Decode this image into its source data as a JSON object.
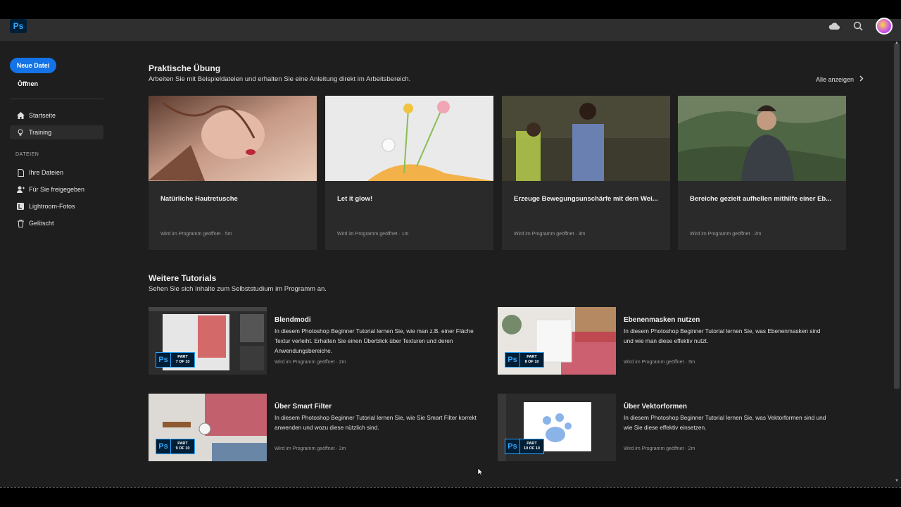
{
  "appbar": {
    "logo": "Ps",
    "cloud_icon": "cloud-icon",
    "search_icon": "search-icon"
  },
  "sidebar": {
    "new_file": "Neue Datei",
    "open": "Öffnen",
    "nav": [
      {
        "label": "Startseite",
        "icon": "home-icon"
      },
      {
        "label": "Training",
        "icon": "lightbulb-icon"
      }
    ],
    "files_heading": "DATEIEN",
    "files": [
      {
        "label": "Ihre Dateien",
        "icon": "file-icon"
      },
      {
        "label": "Für Sie freigegeben",
        "icon": "shared-user-icon"
      },
      {
        "label": "Lightroom-Fotos",
        "icon": "lightroom-icon"
      },
      {
        "label": "Gelöscht",
        "icon": "trash-icon"
      }
    ]
  },
  "practice": {
    "title": "Praktische Übung",
    "subtitle": "Arbeiten Sie mit Beispieldateien und erhalten Sie eine Anleitung direkt im Arbeitsbereich.",
    "see_all": "Alle anzeigen",
    "cards": [
      {
        "title": "Natürliche Hautretusche",
        "meta": "Wird im Programm geöffnet  ·  5m"
      },
      {
        "title": "Let it glow!",
        "meta": "Wird im Programm geöffnet  ·  1m"
      },
      {
        "title": "Erzeuge Bewegungsunschärfe mit dem Wei...",
        "meta": "Wird im Programm geöffnet  ·  3m"
      },
      {
        "title": "Bereiche gezielt aufhellen mithilfe einer Eb...",
        "meta": "Wird im Programm geöffnet  ·  2m"
      }
    ]
  },
  "tutorials": {
    "title": "Weitere Tutorials",
    "subtitle": "Sehen Sie sich Inhalte zum Selbststudium im Programm an.",
    "items": [
      {
        "title": "Blendmodi",
        "desc": "In diesem Photoshop Beginner Tutorial lernen Sie, wie man z.B. einer Fläche Textur verleiht. Erhalten Sie einen Überblick über Texturen und deren Anwendungsbereiche.",
        "meta": "Wird im Programm geöffnet  ·  2m",
        "badge_ps": "Ps",
        "badge_part": "PART",
        "badge_num": "7 OF 10"
      },
      {
        "title": "Ebenenmasken nutzen",
        "desc": "In diesem Photoshop Beginner Tutorial lernen Sie, was Ebenenmasken sind und wie man diese effektiv nutzt.",
        "meta": "Wird im Programm geöffnet  ·  3m",
        "badge_ps": "Ps",
        "badge_part": "PART",
        "badge_num": "8 OF 10"
      },
      {
        "title": "Über Smart Filter",
        "desc": "In diesem Photoshop Beginner Tutorial lernen Sie, wie Sie Smart Filter korrekt anwenden und wozu diese nützlich sind.",
        "meta": "Wird im Programm geöffnet  ·  2m",
        "badge_ps": "Ps",
        "badge_part": "PART",
        "badge_num": "9 OF 10"
      },
      {
        "title": "Über Vektorformen",
        "desc": "In diesem Photoshop Beginner Tutorial lernen Sie, was Vektorformen sind und wie Sie diese effektiv einsetzen.",
        "meta": "Wird im Programm geöffnet  ·  2m",
        "badge_ps": "Ps",
        "badge_part": "PART",
        "badge_num": "10 OF 10"
      }
    ]
  },
  "colors": {
    "accent": "#1473e6",
    "background": "#1e1e1e",
    "card": "#2a2a2a",
    "ps_blue": "#31a8ff"
  }
}
